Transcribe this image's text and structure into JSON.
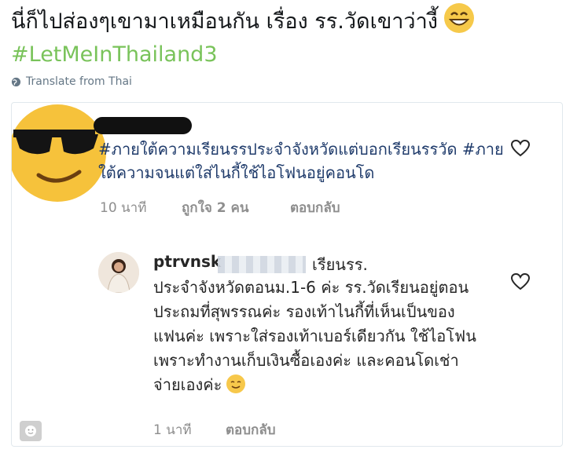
{
  "tweet": {
    "text": "นี่ก็ไปส่องๆเขามาเหมือนกัน เรื่อง รร.วัดเขาว่างี้",
    "hashtag": "#LetMeInThailand3",
    "emoji": "grinning-face"
  },
  "translate_label": "Translate from Thai",
  "comments": [
    {
      "text": "#ภายใต้ความเรียนรรประจำจังหวัดแต่บอกเรียนรรวัด #ภายใต้ความจนแต่ใส่ไนกี้ใช้ไอโฟนอยู่คอนโด",
      "time": "10 นาที",
      "likes": "ถูกใจ 2 คน",
      "reply": "ตอบกลับ"
    },
    {
      "username": "ptrvnsk",
      "first_line": "เรียนรร.",
      "text": "ประจำจังหวัดตอนม.1-6 ค่ะ รร.วัดเรียนอยู่ตอนประถมที่สุพรรณค่ะ รองเท้าไนกี้ที่เห็นเป็นของแฟนค่ะ เพราะใส่รองเท้าเบอร์เดียวกัน ใช้ไอโฟนเพราะทำงานเก็บเงินซื้อเองค่ะ และคอนโดเช่าจ่ายเองค่ะ",
      "emoji": "smiling-face",
      "time": "1 นาที",
      "reply": "ตอบกลับ"
    }
  ],
  "colors": {
    "hashtag": "#79c35a",
    "comment_text": "#1f3b6b",
    "meta": "#8e8e8e"
  }
}
